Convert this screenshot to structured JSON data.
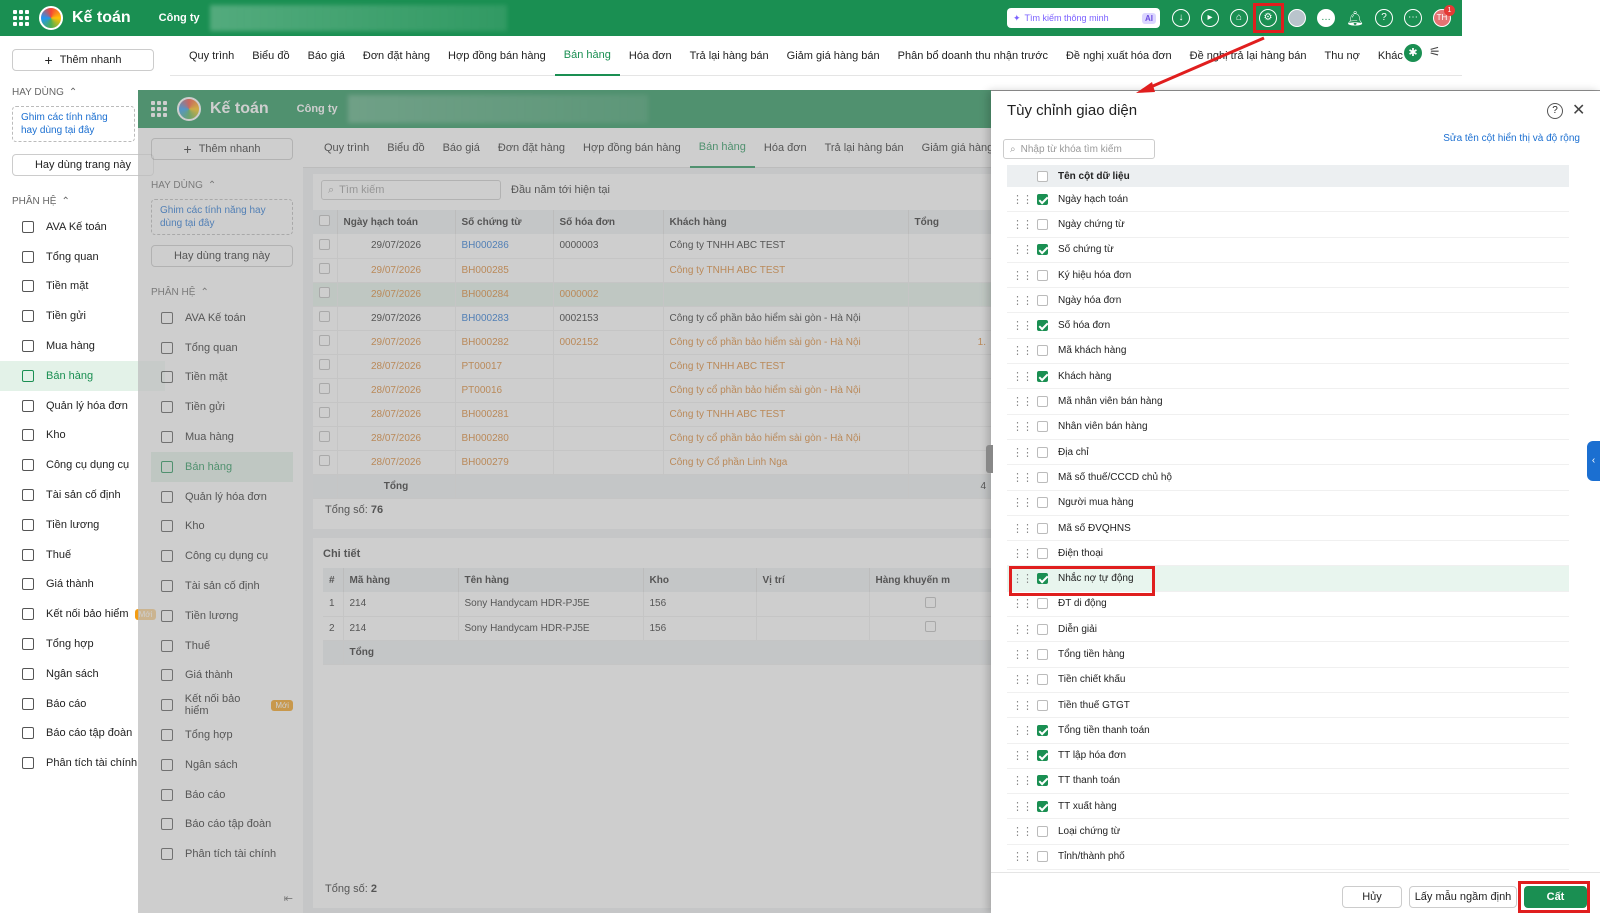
{
  "topbar": {
    "app_title": "Kế toán",
    "company": "Công ty",
    "search_placeholder": "Tìm kiếm thông minh",
    "ai_badge": "AI",
    "notif_count": "1",
    "avatar": "TH"
  },
  "sidebar": {
    "add_label": "Thêm nhanh",
    "favorites_header": "HAY DÙNG",
    "pin_hint": "Ghim các tính năng hay dùng tại đây",
    "favorite_btn": "Hay dùng trang này",
    "modules_header": "PHÂN HỆ",
    "new_badge": "Mới",
    "items": [
      {
        "label": "AVA Kế toán"
      },
      {
        "label": "Tổng quan"
      },
      {
        "label": "Tiền mặt"
      },
      {
        "label": "Tiền gửi"
      },
      {
        "label": "Mua hàng"
      },
      {
        "label": "Bán hàng"
      },
      {
        "label": "Quản lý hóa đơn"
      },
      {
        "label": "Kho"
      },
      {
        "label": "Công cụ dụng cụ"
      },
      {
        "label": "Tài sản cố định"
      },
      {
        "label": "Tiền lương"
      },
      {
        "label": "Thuế"
      },
      {
        "label": "Giá thành"
      },
      {
        "label": "Kết nối bảo hiểm"
      },
      {
        "label": "Tổng hợp"
      },
      {
        "label": "Ngân sách"
      },
      {
        "label": "Báo cáo"
      },
      {
        "label": "Báo cáo tập đoàn"
      },
      {
        "label": "Phân tích tài chính"
      }
    ]
  },
  "tabs": [
    "Quy trình",
    "Biểu đồ",
    "Báo giá",
    "Đơn đặt hàng",
    "Hợp đồng bán hàng",
    "Bán hàng",
    "Hóa đơn",
    "Trả lại hàng bán",
    "Giảm giá hàng bán",
    "Phân bổ doanh thu nhận trước",
    "Đề nghị xuất hóa đơn",
    "Đề nghị trả lại hàng bán",
    "Thu nợ",
    "Khác"
  ],
  "list": {
    "search_placeholder": "Tìm kiếm",
    "period": "Đầu năm tới hiện tại",
    "headers": [
      "Ngày hạch toán",
      "Số chứng từ",
      "Số hóa đơn",
      "Khách hàng",
      "Tổng"
    ],
    "rows": [
      {
        "date": "29/07/2026",
        "doc": "BH000286",
        "inv": "0000003",
        "customer": "Công ty TNHH ABC TEST",
        "style": "normal"
      },
      {
        "date": "29/07/2026",
        "doc": "BH000285",
        "inv": "",
        "customer": "Công ty TNHH ABC TEST",
        "style": "orange"
      },
      {
        "date": "29/07/2026",
        "doc": "BH000284",
        "inv": "0000002",
        "customer": "",
        "style": "orange sel"
      },
      {
        "date": "29/07/2026",
        "doc": "BH000283",
        "inv": "0002153",
        "customer": "Công ty cổ phần bảo hiểm sài gòn - Hà Nội",
        "style": "normal"
      },
      {
        "date": "29/07/2026",
        "doc": "BH000282",
        "inv": "0002152",
        "customer": "Công ty cổ phần bảo hiểm sài gòn - Hà Nội",
        "style": "orange"
      },
      {
        "date": "28/07/2026",
        "doc": "PT00017",
        "inv": "",
        "customer": "Công ty TNHH ABC TEST",
        "style": "orange"
      },
      {
        "date": "28/07/2026",
        "doc": "PT00016",
        "inv": "",
        "customer": "Công ty cổ phần bảo hiểm sài gòn - Hà Nội",
        "style": "orange"
      },
      {
        "date": "28/07/2026",
        "doc": "BH000281",
        "inv": "",
        "customer": "Công ty TNHH ABC TEST",
        "style": "orange"
      },
      {
        "date": "28/07/2026",
        "doc": "BH000280",
        "inv": "",
        "customer": "Công ty cổ phần bảo hiểm sài gòn - Hà Nội",
        "style": "orange"
      },
      {
        "date": "28/07/2026",
        "doc": "BH000279",
        "inv": "",
        "customer": "Công ty Cổ phần Linh Nga",
        "style": "orange"
      }
    ],
    "total_label": "Tổng",
    "total_partial": "4",
    "extra_1": "1.",
    "count_label": "Tổng số:",
    "count": "76"
  },
  "detail": {
    "title": "Chi tiết",
    "headers": [
      "#",
      "Mã hàng",
      "Tên hàng",
      "Kho",
      "Vị trí",
      "Hàng khuyến m"
    ],
    "rows": [
      {
        "n": "1",
        "code": "214",
        "name": "Sony Handycam HDR-PJ5E",
        "wh": "156"
      },
      {
        "n": "2",
        "code": "214",
        "name": "Sony Handycam HDR-PJ5E",
        "wh": "156"
      }
    ],
    "total_label": "Tổng",
    "count_label": "Tổng số:",
    "count": "2"
  },
  "panel": {
    "title": "Tùy chỉnh giao diện",
    "search_placeholder": "Nhập từ khóa tìm kiếm",
    "rename_link": "Sửa tên cột hiển thị và độ rộng",
    "col_header": "Tên cột dữ liệu",
    "columns": [
      {
        "label": "Ngày hạch toán",
        "checked": true
      },
      {
        "label": "Ngày chứng từ",
        "checked": false
      },
      {
        "label": "Số chứng từ",
        "checked": true
      },
      {
        "label": "Ký hiệu hóa đơn",
        "checked": false
      },
      {
        "label": "Ngày hóa đơn",
        "checked": false
      },
      {
        "label": "Số hóa đơn",
        "checked": true
      },
      {
        "label": "Mã khách hàng",
        "checked": false
      },
      {
        "label": "Khách hàng",
        "checked": true
      },
      {
        "label": "Mã nhân viên bán hàng",
        "checked": false
      },
      {
        "label": "Nhân viên bán hàng",
        "checked": false
      },
      {
        "label": "Địa chỉ",
        "checked": false
      },
      {
        "label": "Mã số thuế/CCCD chủ hộ",
        "checked": false
      },
      {
        "label": "Người mua hàng",
        "checked": false
      },
      {
        "label": "Mã số ĐVQHNS",
        "checked": false
      },
      {
        "label": "Điện thoại",
        "checked": false
      },
      {
        "label": "Nhắc nợ tự động",
        "checked": true
      },
      {
        "label": "ĐT di động",
        "checked": false
      },
      {
        "label": "Diễn giải",
        "checked": false
      },
      {
        "label": "Tổng tiền hàng",
        "checked": false
      },
      {
        "label": "Tiền chiết khấu",
        "checked": false
      },
      {
        "label": "Tiền thuế GTGT",
        "checked": false
      },
      {
        "label": "Tổng tiền thanh toán",
        "checked": true
      },
      {
        "label": "TT lập hóa đơn",
        "checked": true
      },
      {
        "label": "TT thanh toán",
        "checked": true
      },
      {
        "label": "TT xuất hàng",
        "checked": true
      },
      {
        "label": "Loại chứng từ",
        "checked": false
      },
      {
        "label": "Tỉnh/thành phố",
        "checked": false
      }
    ],
    "cancel": "Hủy",
    "default": "Lấy mẫu ngầm định",
    "save": "Cất"
  },
  "colors": {
    "brand": "#1a8f52",
    "highlight": "#e01e1e"
  }
}
